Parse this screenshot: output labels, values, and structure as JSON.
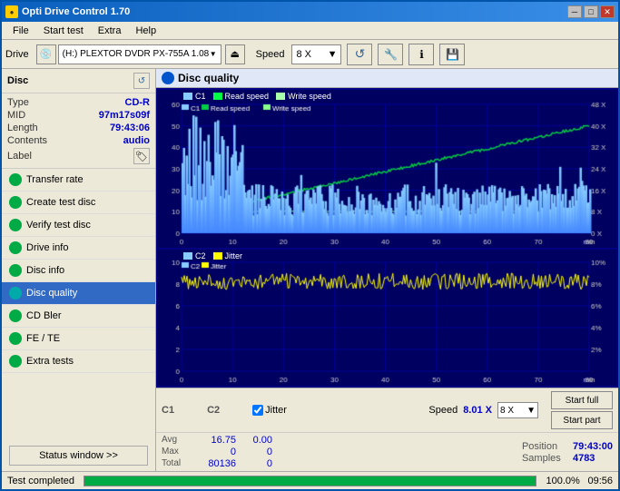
{
  "window": {
    "title": "Opti Drive Control 1.70",
    "title_icon": "●"
  },
  "menu": {
    "items": [
      "File",
      "Start test",
      "Extra",
      "Help"
    ]
  },
  "toolbar": {
    "drive_label": "Drive",
    "drive_value": "(H:)  PLEXTOR DVDR  PX-755A 1.08",
    "speed_label": "Speed",
    "speed_value": "8 X"
  },
  "disc": {
    "title": "Disc",
    "type_label": "Type",
    "type_value": "CD-R",
    "mid_label": "MID",
    "mid_value": "97m17s09f",
    "length_label": "Length",
    "length_value": "79:43:06",
    "contents_label": "Contents",
    "contents_value": "audio",
    "label_label": "Label"
  },
  "nav": {
    "items": [
      {
        "id": "transfer-rate",
        "label": "Transfer rate",
        "icon": "green"
      },
      {
        "id": "create-test-disc",
        "label": "Create test disc",
        "icon": "green"
      },
      {
        "id": "verify-test-disc",
        "label": "Verify test disc",
        "icon": "green"
      },
      {
        "id": "drive-info",
        "label": "Drive info",
        "icon": "green"
      },
      {
        "id": "disc-info",
        "label": "Disc info",
        "icon": "green"
      },
      {
        "id": "disc-quality",
        "label": "Disc quality",
        "icon": "blue",
        "active": true
      },
      {
        "id": "cd-bler",
        "label": "CD Bler",
        "icon": "green"
      },
      {
        "id": "fe-te",
        "label": "FE / TE",
        "icon": "green"
      },
      {
        "id": "extra-tests",
        "label": "Extra tests",
        "icon": "green"
      }
    ],
    "status_btn": "Status window >>"
  },
  "chart1": {
    "title": "Disc quality",
    "legend": [
      {
        "color": "#00aaff",
        "label": "C1"
      },
      {
        "color": "#00ff44",
        "label": "Read speed"
      },
      {
        "color": "#aaffaa",
        "label": "Write speed"
      }
    ],
    "y_labels": [
      "60",
      "50",
      "40",
      "30",
      "20",
      "10",
      "0"
    ],
    "x_labels": [
      "0",
      "10",
      "20",
      "30",
      "40",
      "50",
      "60",
      "70",
      "80"
    ],
    "r_labels": [
      "48 X",
      "40 X",
      "32 X",
      "24 X",
      "16 X",
      "8 X",
      "0 X"
    ],
    "unit": "min"
  },
  "chart2": {
    "legend": [
      {
        "color": "#00aaff",
        "label": "C2"
      },
      {
        "color": "#ffff00",
        "label": "Jitter"
      }
    ],
    "y_labels": [
      "10",
      "9",
      "8",
      "7",
      "6",
      "5",
      "4",
      "3",
      "2",
      "1",
      "0"
    ],
    "x_labels": [
      "0",
      "10",
      "20",
      "30",
      "40",
      "50",
      "60",
      "70",
      "80"
    ],
    "r_labels": [
      "10%",
      "8%",
      "6%",
      "4%",
      "2%",
      ""
    ],
    "unit": "min"
  },
  "bottom": {
    "c1_label": "C1",
    "c2_label": "C2",
    "jitter_label": "Jitter",
    "jitter_checked": true,
    "speed_label": "Speed",
    "speed_value": "8.01 X",
    "speed_select": "8 X",
    "start_full": "Start full",
    "start_part": "Start part",
    "avg_label": "Avg",
    "avg_c1": "16.75",
    "avg_c2": "0.00",
    "max_label": "Max",
    "max_c1": "0",
    "max_c2": "0",
    "total_label": "Total",
    "total_c1": "80136",
    "total_c2": "0",
    "position_label": "Position",
    "position_value": "79:43:00",
    "samples_label": "Samples",
    "samples_value": "4783"
  },
  "statusbar": {
    "text": "Test completed",
    "progress": 100,
    "progress_label": "100.0%",
    "time": "09:56"
  }
}
